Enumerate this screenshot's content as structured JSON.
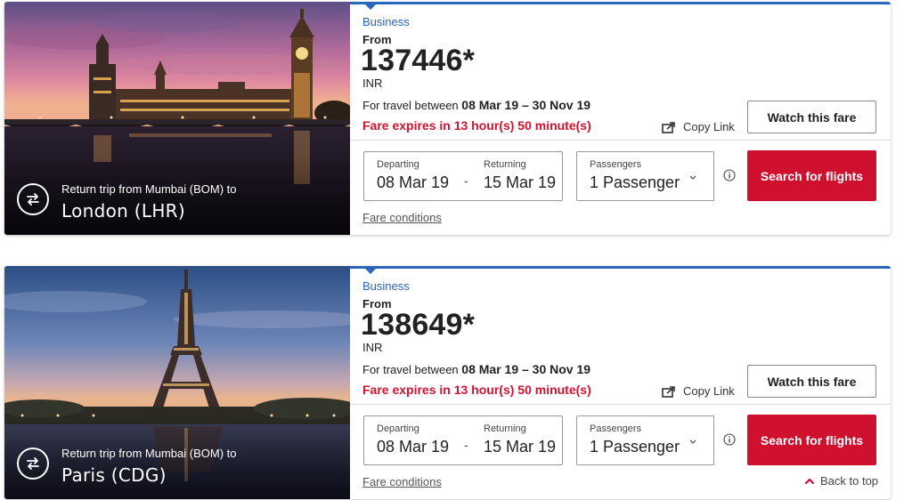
{
  "cards": [
    {
      "cabin": "Business",
      "from_label": "From",
      "price": "137446*",
      "currency": "INR",
      "travel_prefix": "For travel between",
      "travel_range": "08 Mar 19 – 30 Nov 19",
      "expires": "Fare expires in 13 hour(s) 50 minute(s)",
      "copy_link": "Copy Link",
      "watch": "Watch this fare",
      "departing_label": "Departing",
      "departing_value": "08 Mar 19",
      "date_separator": "-",
      "returning_label": "Returning",
      "returning_value": "15 Mar 19",
      "passengers_label": "Passengers",
      "passengers_value": "1 Passenger",
      "search": "Search for flights",
      "fare_conditions": "Fare conditions",
      "trip_subtitle": "Return trip from Mumbai (BOM) to",
      "trip_city": "London (LHR)",
      "hero_icon": "return-trip-icon"
    },
    {
      "cabin": "Business",
      "from_label": "From",
      "price": "138649*",
      "currency": "INR",
      "travel_prefix": "For travel between",
      "travel_range": "08 Mar 19 – 30 Nov 19",
      "expires": "Fare expires in 13 hour(s) 50 minute(s)",
      "copy_link": "Copy Link",
      "watch": "Watch this fare",
      "departing_label": "Departing",
      "departing_value": "08 Mar 19",
      "date_separator": "-",
      "returning_label": "Returning",
      "returning_value": "15 Mar 19",
      "passengers_label": "Passengers",
      "passengers_value": "1 Passenger",
      "search": "Search for flights",
      "fare_conditions": "Fare conditions",
      "trip_subtitle": "Return trip from Mumbai (BOM) to",
      "trip_city": "Paris (CDG)",
      "hero_icon": "return-trip-icon"
    }
  ],
  "back_to_top": "Back to top",
  "colors": {
    "accent_blue": "#2a66bd",
    "brand_red": "#d0102f",
    "expiry_red": "#d6112d"
  }
}
